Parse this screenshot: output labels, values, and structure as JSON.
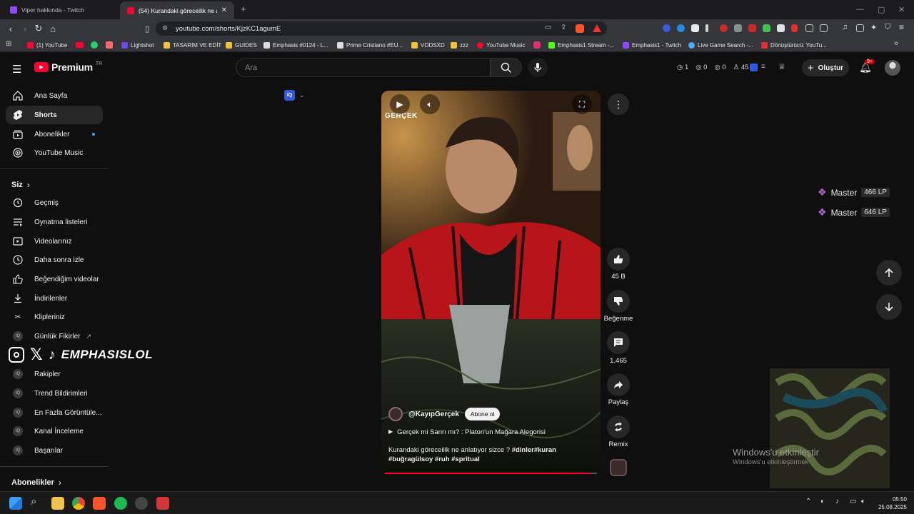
{
  "tabs": [
    {
      "title": "Viper hakkında - Twitch",
      "active": false
    },
    {
      "title": "(54) Kurandaki göreceilik ne anl...",
      "active": true
    }
  ],
  "address": {
    "url": "youtube.com/shorts/KjzKC1agumE"
  },
  "bookmarks": [
    "(1) YouTube",
    "Lightshot",
    "TASARIM VE EDİT",
    "GUIDES",
    "Emphasis #0124 - L...",
    "Prime Cristiano #EU...",
    "VODSXD",
    "zzz",
    "YouTube Music",
    "Emphasis1 Stream -...",
    "Emphasis1 - Twitch",
    "Live Game Search -...",
    "Dönüştürücü: YouTu..."
  ],
  "header": {
    "logo_text": "Premium",
    "logo_region": "TR",
    "search_placeholder": "Ara",
    "create_label": "Oluştur",
    "notif_count": "9+",
    "stats": [
      {
        "icon": "clock-icon",
        "value": "1"
      },
      {
        "icon": "eye-icon",
        "value": "0"
      },
      {
        "icon": "eye-icon",
        "value": "0"
      },
      {
        "icon": "user-icon",
        "value": "45"
      }
    ]
  },
  "sidebar": {
    "main": [
      {
        "label": "Ana Sayfa",
        "icon": "home-icon"
      },
      {
        "label": "Shorts",
        "icon": "shorts-icon",
        "active": true
      },
      {
        "label": "Abonelikler",
        "icon": "subscriptions-icon",
        "dot": true
      },
      {
        "label": "YouTube Music",
        "icon": "music-icon"
      }
    ],
    "you_header": "Siz",
    "you": [
      {
        "label": "Geçmiş",
        "icon": "history-icon"
      },
      {
        "label": "Oynatma listeleri",
        "icon": "playlist-icon"
      },
      {
        "label": "Videolarınız",
        "icon": "video-icon"
      },
      {
        "label": "Daha sonra izle",
        "icon": "clock-icon"
      },
      {
        "label": "Beğendiğim videolar",
        "icon": "thumbs-up-icon"
      },
      {
        "label": "İndirilenler",
        "icon": "download-icon"
      },
      {
        "label": "Klipleriniz",
        "icon": "scissors-icon"
      }
    ],
    "tools": [
      "Günlük Fikirler",
      "Rakipler",
      "Trend Bildirimleri",
      "En Fazla Görüntüle...",
      "Kanal İnceleme",
      "Başarılar"
    ],
    "subs_header": "Abonelikler"
  },
  "overlay": {
    "brand": "EMPHASISLOL",
    "watermark_line1": "Windows'u etkinleştir",
    "watermark_line2": "Windows'u etkinleştirmek"
  },
  "short": {
    "channel": "@KayıpGerçek",
    "subscribe_label": "Abone ol",
    "playlist_title": "Gerçek mi Sanrı mı? : Platon'un Mağara Alegorisi",
    "caption_text": "Kurandaki göreceilik ne anlatıyor sizce ?",
    "caption_tags_1": "#dinler#kuran",
    "caption_tags_2": "#buğragülsoy #ruh #spritual",
    "channel_watermark": "GERÇEK",
    "progress": 0.97
  },
  "actions": {
    "likes": "45 B",
    "dislike_label": "Beğenme",
    "comments": "1.465",
    "share_label": "Paylaş",
    "remix_label": "Remix"
  },
  "rank": [
    {
      "tier": "Master",
      "lp": "466 LP"
    },
    {
      "tier": "Master",
      "lp": "646 LP"
    }
  ],
  "clock": {
    "time": "05:50",
    "date": "25.08.2025"
  },
  "colors": {
    "accent": "#ff0033",
    "bg": "#0f0f0f",
    "chip": "#272727"
  }
}
